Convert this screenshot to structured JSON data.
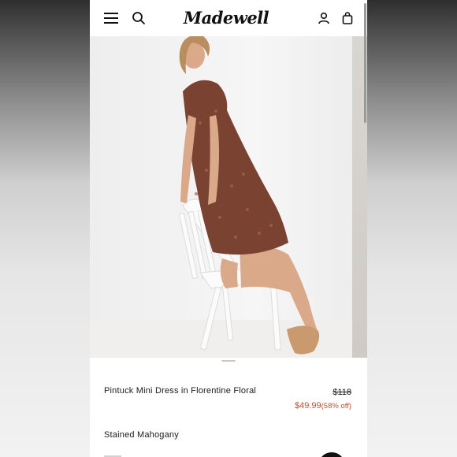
{
  "header": {
    "logo_text": "Madewell",
    "icons": [
      "menu-icon",
      "search-icon",
      "account-icon",
      "bag-icon"
    ]
  },
  "product": {
    "name": "Pintuck Mini Dress in Florentine Floral",
    "original_price": "$118",
    "sale_price": "$49.99",
    "discount": "(58% off)",
    "color": "Stained Mahogany"
  },
  "colors": {
    "sale": "#b4542f",
    "dress": "#7a4230",
    "sandal": "#c99a6e",
    "skin": "#d9a98a"
  }
}
